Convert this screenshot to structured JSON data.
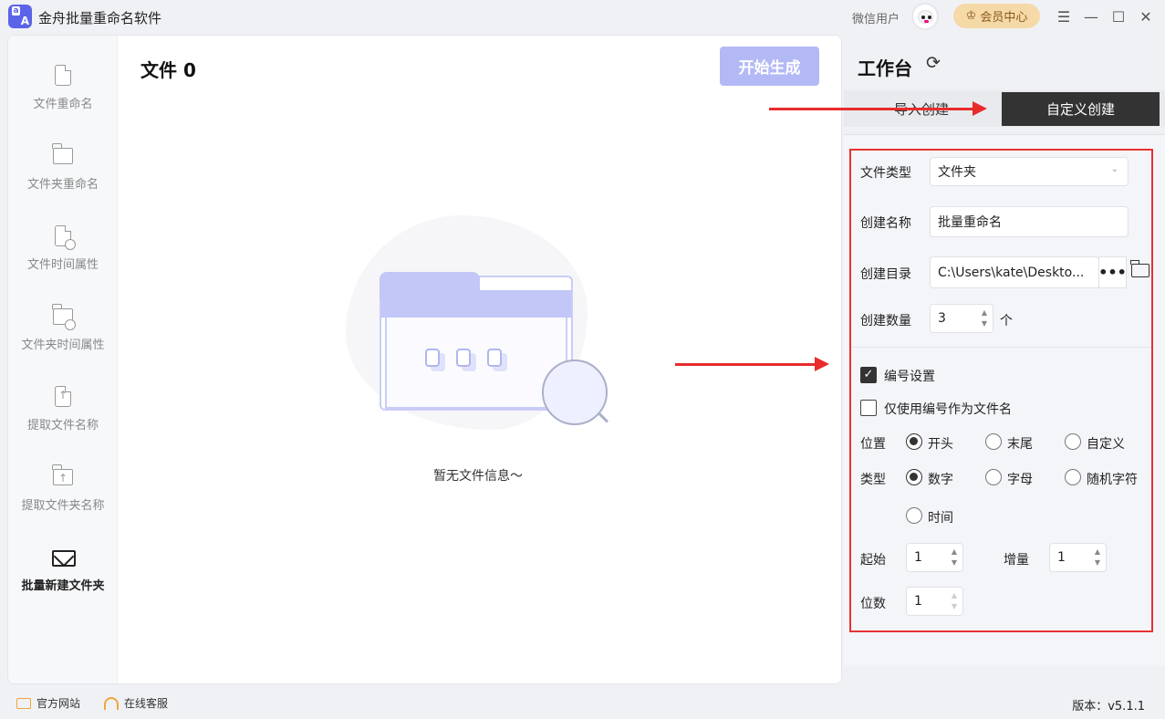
{
  "app": {
    "title": "金舟批量重命名软件",
    "logo_top": "a",
    "logo_bottom": "A"
  },
  "titlebar": {
    "user_label": "微信用户",
    "vip_label": "会员中心",
    "minimize": "☰",
    "min": "—",
    "max": "☐",
    "close": "✕"
  },
  "sidebar": {
    "items": [
      {
        "label": "文件重命名"
      },
      {
        "label": "文件夹重命名"
      },
      {
        "label": "文件时间属性"
      },
      {
        "label": "文件夹时间属性"
      },
      {
        "label": "提取文件名称"
      },
      {
        "label": "提取文件夹名称"
      },
      {
        "label": "批量新建文件夹"
      }
    ]
  },
  "main": {
    "file_header": "文件 0",
    "start_button": "开始生成",
    "empty_text": "暂无文件信息～"
  },
  "workbench": {
    "title": "工作台",
    "tabs": {
      "import": "导入创建",
      "custom": "自定义创建"
    },
    "form": {
      "file_type_label": "文件类型",
      "file_type_value": "文件夹",
      "name_label": "创建名称",
      "name_value": "批量重命名",
      "dir_label": "创建目录",
      "dir_value": "C:\\Users\\kate\\Deskto...",
      "dir_button": "•••",
      "count_label": "创建数量",
      "count_value": "3",
      "count_unit": "个",
      "numbering_label": "编号设置",
      "numbering_checked": true,
      "only_number_label": "仅使用编号作为文件名",
      "only_number_checked": false,
      "position_label": "位置",
      "position_options": [
        "开头",
        "末尾",
        "自定义"
      ],
      "position_selected": "开头",
      "type_label": "类型",
      "type_options": [
        "数字",
        "字母",
        "随机字符",
        "时间"
      ],
      "type_selected": "数字",
      "start_label": "起始",
      "start_value": "1",
      "increment_label": "增量",
      "increment_value": "1",
      "digits_label": "位数",
      "digits_value": "1"
    }
  },
  "bottom": {
    "site_label": "官方网站",
    "service_label": "在线客服",
    "version": "版本：v5.1.1"
  }
}
